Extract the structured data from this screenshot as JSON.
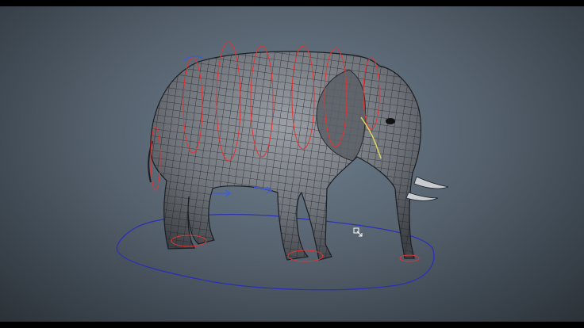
{
  "viewport": {
    "background_center": "#6e7f8f",
    "background_edge": "#2b3137"
  },
  "scene": {
    "mesh_color": "#1b1e22",
    "mesh_fill": "#6f747a",
    "control_curve_color": "#e23434",
    "ground_curve_color": "#2a2fb8",
    "selected_curve_color": "#e0d85a",
    "cursor_icon": "crosshair-cursor-icon"
  }
}
